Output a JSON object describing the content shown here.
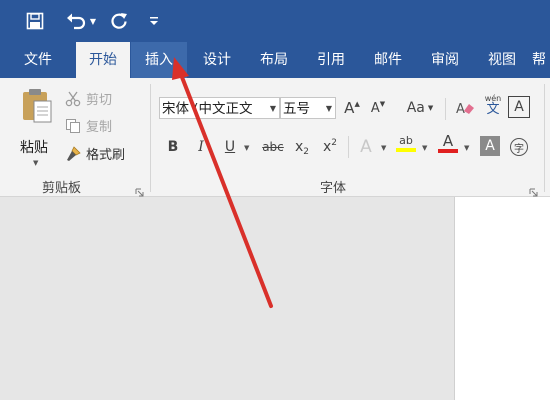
{
  "colors": {
    "brand": "#2b579a",
    "ribbon_bg": "#f3f3f3",
    "canvas": "#e6e6e6",
    "annotation_arrow": "#d9302a"
  },
  "qat": {
    "save_icon": "save-icon",
    "undo_icon": "undo-icon",
    "redo_icon": "redo-icon",
    "customize_icon": "customize-qat-icon"
  },
  "tabs": [
    {
      "label": "文件"
    },
    {
      "label": "开始"
    },
    {
      "label": "插入"
    },
    {
      "label": "设计"
    },
    {
      "label": "布局"
    },
    {
      "label": "引用"
    },
    {
      "label": "邮件"
    },
    {
      "label": "审阅"
    },
    {
      "label": "视图"
    },
    {
      "label": "帮"
    }
  ],
  "clipboard": {
    "paste_label": "粘贴",
    "cut_label": "剪切",
    "copy_label": "复制",
    "format_painter_label": "格式刷",
    "group_label": "剪贴板"
  },
  "font": {
    "font_name": "宋体 (中文正文",
    "font_size": "五号",
    "group_label": "字体",
    "grow_icon": "A",
    "shrink_icon": "A",
    "case_icon": "Aa",
    "phonetic_top": "wén",
    "phonetic_bottom": "文",
    "border_char": "A",
    "bold": "B",
    "italic": "I",
    "underline": "U",
    "strike": "abc",
    "subscript_base": "x",
    "subscript_mark": "2",
    "superscript_base": "x",
    "superscript_mark": "2",
    "effects": "A",
    "highlight": "ab",
    "font_color": "A",
    "shading": "A",
    "enclose": "字"
  }
}
